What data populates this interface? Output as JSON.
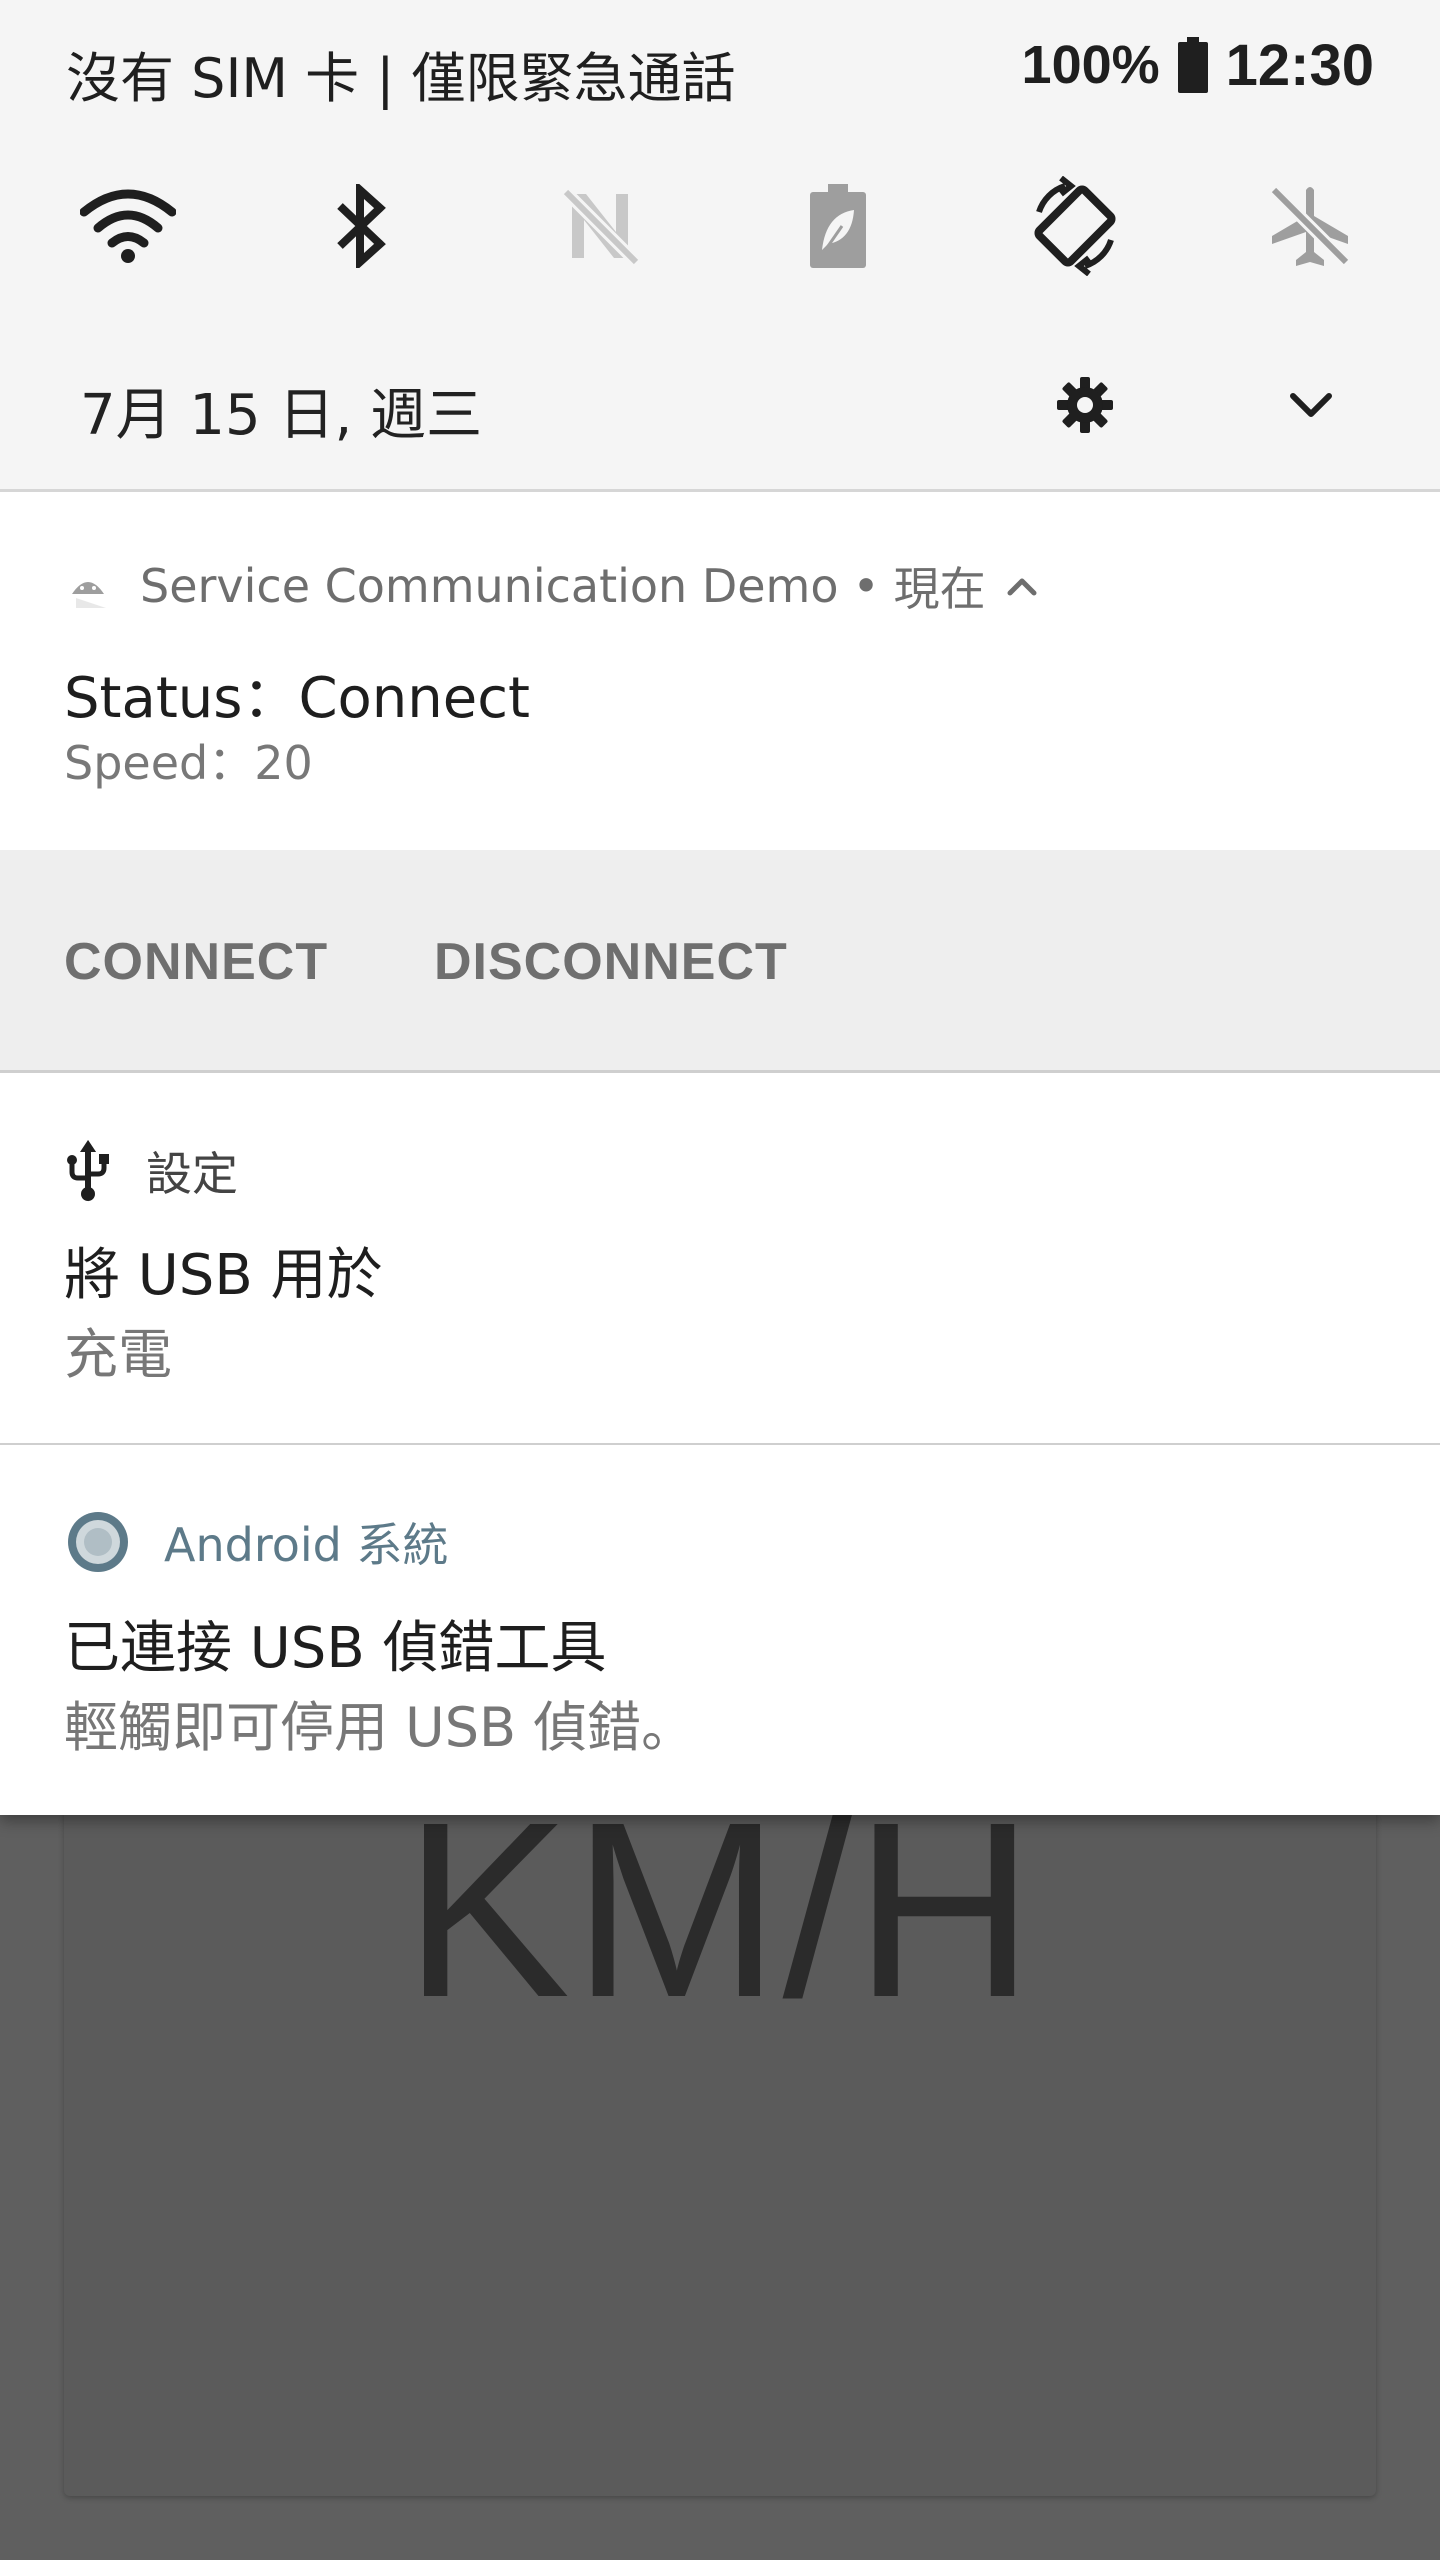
{
  "status_bar": {
    "carrier": "沒有 SIM 卡 | 僅限緊急通話",
    "battery_percent": "100%",
    "time": "12:30"
  },
  "quick_settings": {
    "tiles": [
      {
        "name": "wifi",
        "icon": "wifi-icon",
        "state": "on"
      },
      {
        "name": "bluetooth",
        "icon": "bluetooth-icon",
        "state": "on"
      },
      {
        "name": "mobile-data",
        "icon": "mobile-data-off-icon",
        "state": "disabled"
      },
      {
        "name": "battery-saver",
        "icon": "battery-saver-icon",
        "state": "off"
      },
      {
        "name": "auto-rotate",
        "icon": "auto-rotate-icon",
        "state": "on"
      },
      {
        "name": "airplane-mode",
        "icon": "airplane-icon",
        "state": "off"
      }
    ],
    "date": "7月 15 日, 週三"
  },
  "notifications": [
    {
      "app": "Service Communication Demo",
      "time": "現在",
      "title": "Status：Connect",
      "text": "Speed：20",
      "actions": [
        "CONNECT",
        "DISCONNECT"
      ]
    },
    {
      "app": "設定",
      "title": "將 USB 用於",
      "text": "充電"
    },
    {
      "app": "Android 系統",
      "title": "已連接 USB 偵錯工具",
      "text": "輕觸即可停用 USB 偵錯。"
    }
  ],
  "background_app": {
    "unit_label": "KM/H"
  },
  "colors": {
    "qs_background": "#f5f5f5",
    "action_bar": "#eeeeee",
    "android_accent": "#5d7a89",
    "scrim": "#5f5f5f"
  }
}
